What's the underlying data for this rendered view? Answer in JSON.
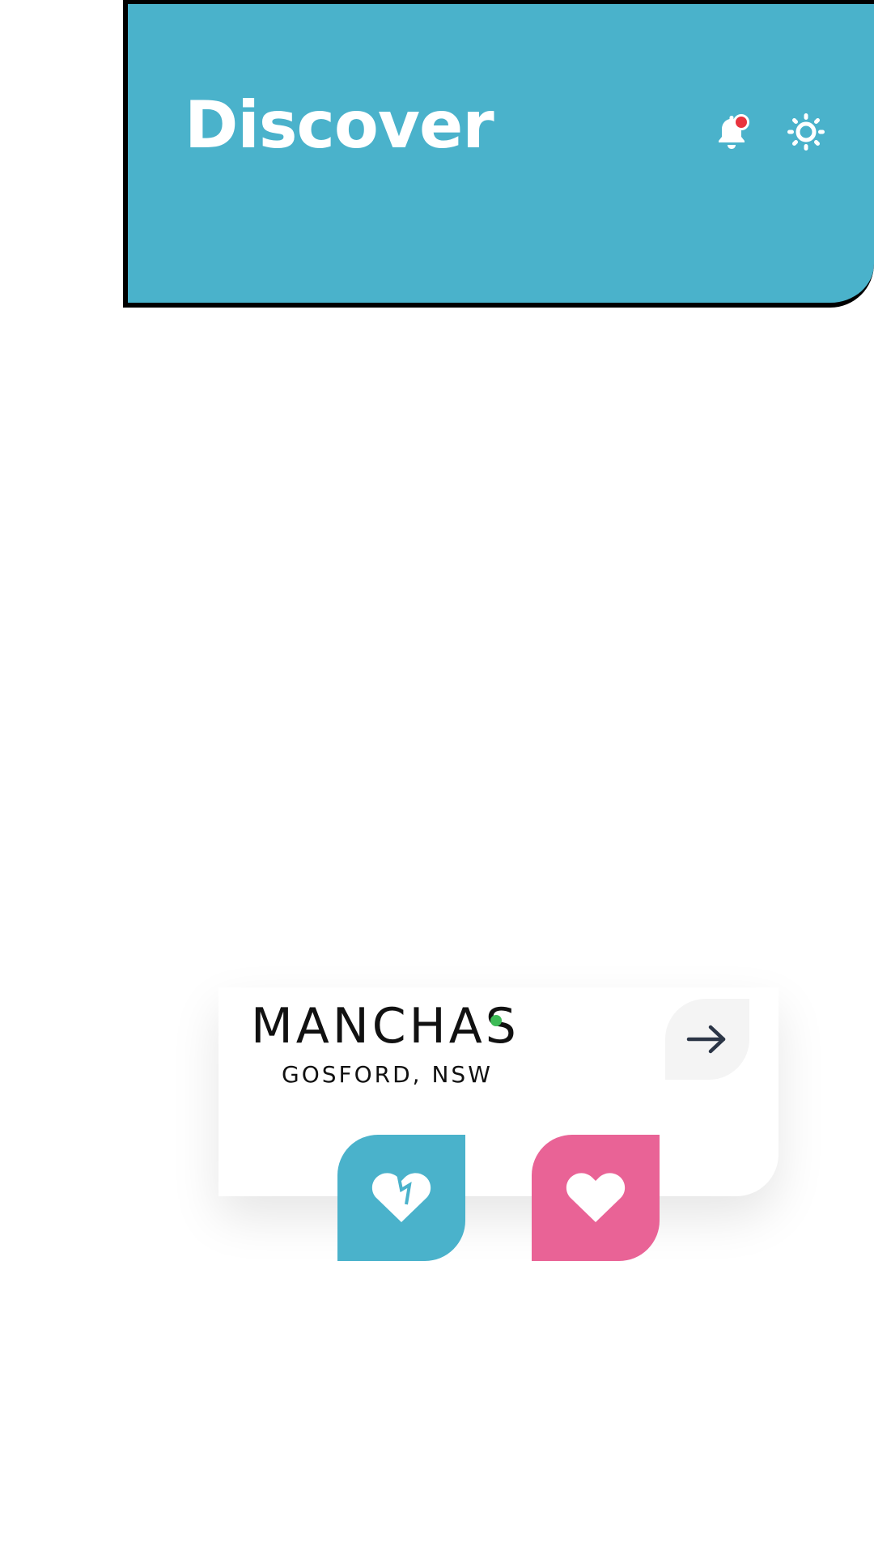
{
  "header": {
    "title": "Discover",
    "background_color": "#4AB2CB",
    "icons": [
      "bell-icon",
      "gear-icon"
    ],
    "notification_badge_color": "#E8343E"
  },
  "card": {
    "name": "MANCHAS",
    "location": "GOSFORD, NSW",
    "status_color": "#3DBB56",
    "open_icon": "arrow-right-icon"
  },
  "actions": {
    "dislike_icon": "broken-heart-icon",
    "dislike_color": "#4AB2CB",
    "like_icon": "heart-icon",
    "like_color": "#E96396"
  }
}
